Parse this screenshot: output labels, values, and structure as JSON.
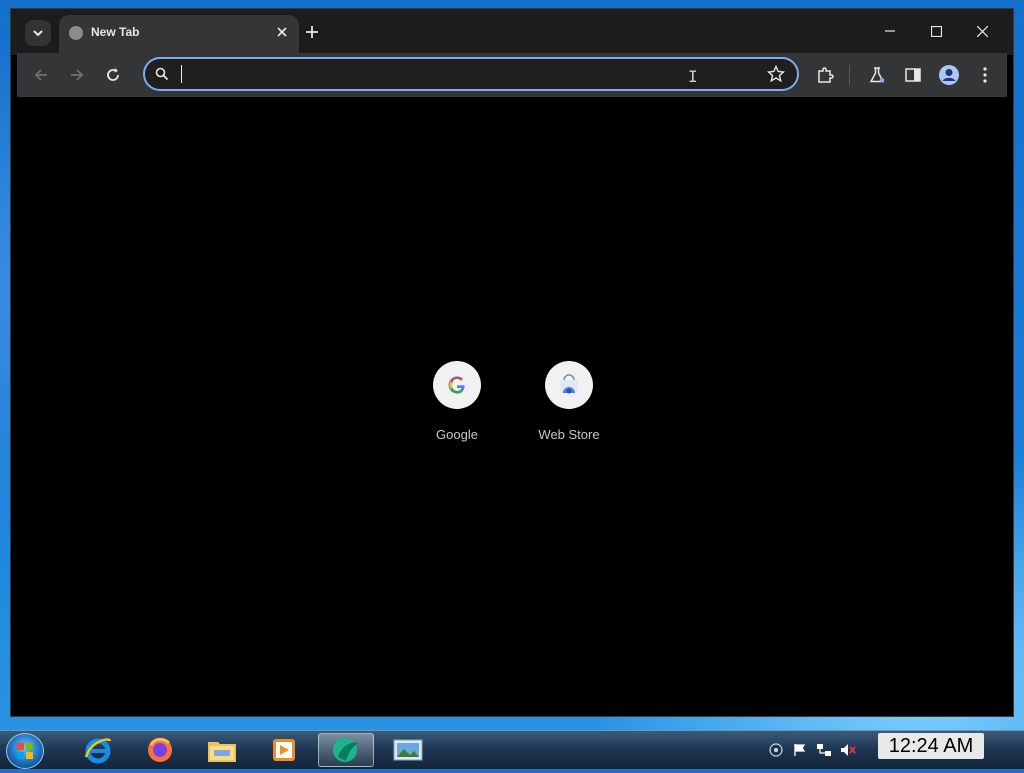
{
  "browser": {
    "tab": {
      "title": "New Tab"
    },
    "omnibox": {
      "value": "",
      "placeholder": ""
    },
    "accent_color": "#7cacf8",
    "background_color": "#000000",
    "toolbar_color": "#333536"
  },
  "shortcuts": [
    {
      "label": "Google",
      "icon": "google-icon"
    },
    {
      "label": "Web Store",
      "icon": "web-store-icon"
    }
  ],
  "taskbar": {
    "clock": "12:24 AM",
    "apps": [
      "internet-explorer-icon",
      "firefox-icon",
      "file-explorer-icon",
      "media-player-icon",
      "app-icon",
      "image-viewer-icon"
    ]
  }
}
